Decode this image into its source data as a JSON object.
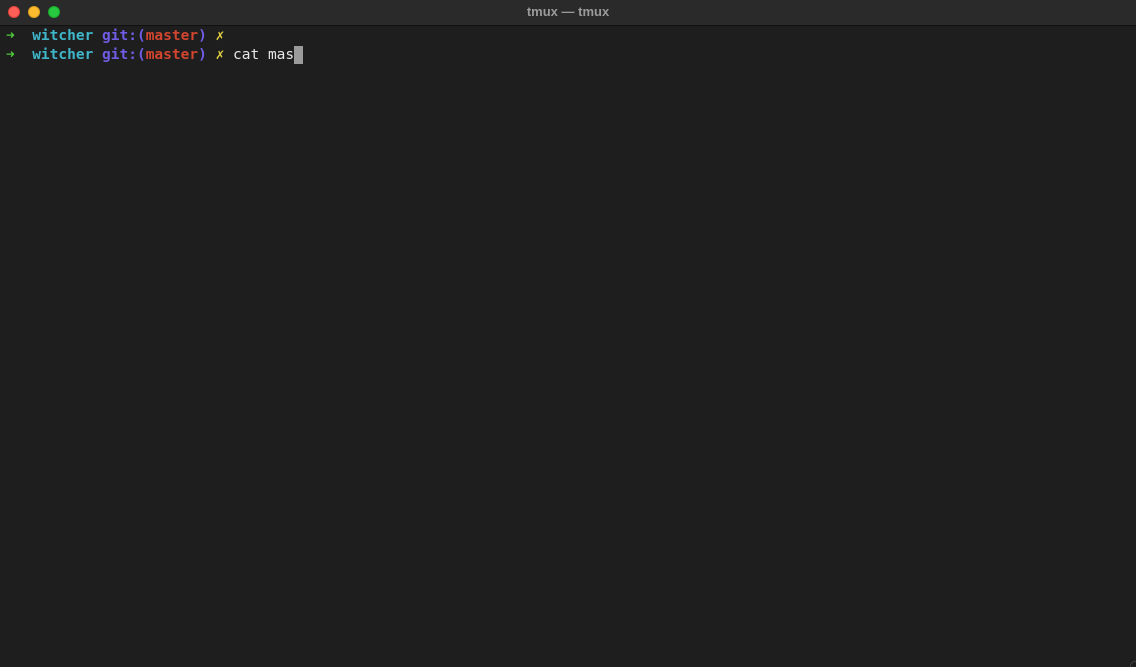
{
  "window": {
    "title": "tmux — tmux"
  },
  "terminal": {
    "lines": [
      {
        "arrow": "➜",
        "directory": "witcher",
        "git_prefix": "git:(",
        "branch": "master",
        "git_suffix": ")",
        "dirty_marker": "✗",
        "command": ""
      },
      {
        "arrow": "➜",
        "directory": "witcher",
        "git_prefix": "git:(",
        "branch": "master",
        "git_suffix": ")",
        "dirty_marker": "✗",
        "command": "cat mas"
      }
    ]
  },
  "colors": {
    "background": "#1e1e1e",
    "arrow": "#4fc93b",
    "directory": "#3fb6c9",
    "git": "#6f5de6",
    "branch": "#d2452f",
    "dirty": "#e2d041",
    "text": "#e6e6e6",
    "cursor": "#9b9b9b"
  },
  "icons": {
    "close": "close-icon",
    "minimize": "minimize-icon",
    "zoom": "zoom-icon"
  }
}
